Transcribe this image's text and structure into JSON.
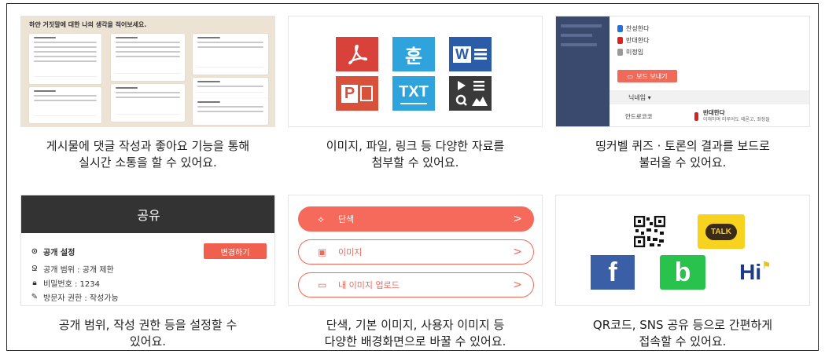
{
  "cells": [
    {
      "caption_line1": "게시물에 댓글 작성과 좋아요 기능을 통해",
      "caption_line2": "실시간 소통을 할 수 있어요.",
      "board_title": "하얀 거짓말에 대한 나의 생각을 적어보세요."
    },
    {
      "caption_line1": "이미지, 파일, 링크 등 다양한 자료를",
      "caption_line2": "첨부할 수 있어요.",
      "icons": [
        "pdf-icon",
        "hwp-icon",
        "word-icon",
        "powerpoint-icon",
        "txt-icon",
        "media-icon"
      ],
      "hwp_label": "훈",
      "txt_label": "TXT",
      "word_label": "W",
      "ppt_label": "P"
    },
    {
      "caption_line1": "띵커벨 퀴즈 · 토론의 결과를 보드로",
      "caption_line2": "불러올 수 있어요.",
      "options": [
        "찬성한다",
        "반대한다",
        "미정임"
      ],
      "send_button": "보드 보내기",
      "nickname_header": "닉네임 ▾",
      "row_name": "안드로코코",
      "row_vote": "반대한다",
      "row_comment": "이해하며 미루어도 때론고, 좌장들"
    },
    {
      "caption_line1": "공개 범위, 작성 권한 등을 설정할 수",
      "caption_line2": "있어요.",
      "header": "공유",
      "section_title": "공개 설정",
      "change_button": "변경하기",
      "rows": [
        "공개 범위 : 공개 제한",
        "비밀번호 : 1234",
        "방문자 권한 : 작성가능"
      ]
    },
    {
      "caption_line1": "단색, 기본 이미지, 사용자 이미지 등",
      "caption_line2": "다양한 배경화면으로 바꿀 수 있어요.",
      "options": [
        "단색",
        "이미지",
        "내 이미지 업로드"
      ],
      "arrow": ">"
    },
    {
      "caption_line1": "QR코드, SNS 공유 등으로 간편하게",
      "caption_line2": "접속할 수 있어요.",
      "talk_label": "TALK",
      "facebook_label": "f",
      "band_label": "b",
      "hi_label": "Hi"
    }
  ],
  "colors": {
    "accent": "#f06a5a",
    "pdf": "#d9413b",
    "hwp": "#2fa4dc",
    "word": "#2a5ca8",
    "ppt": "#d9513b",
    "txt": "#2fa4dc",
    "kakao": "#f7d21e",
    "facebook": "#3b5fa6",
    "band": "#29c24d"
  }
}
